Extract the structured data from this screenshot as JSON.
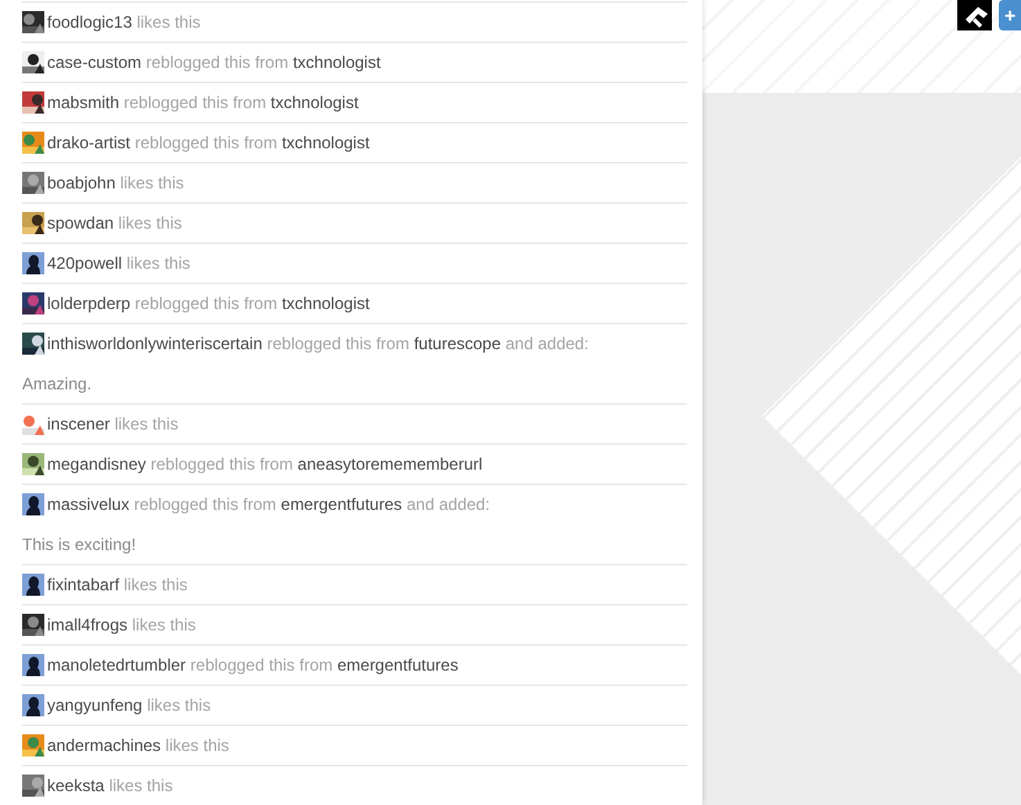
{
  "notes": [
    {
      "kind": "like",
      "user": "foodlogic13",
      "action": "likes this"
    },
    {
      "kind": "reblog",
      "user": "case-custom",
      "action": "reblogged this from",
      "source": "txchnologist"
    },
    {
      "kind": "reblog",
      "user": "mabsmith",
      "action": "reblogged this from",
      "source": "txchnologist"
    },
    {
      "kind": "reblog",
      "user": "drako-artist",
      "action": "reblogged this from",
      "source": "txchnologist"
    },
    {
      "kind": "like",
      "user": "boabjohn",
      "action": "likes this"
    },
    {
      "kind": "like",
      "user": "spowdan",
      "action": "likes this"
    },
    {
      "kind": "like",
      "avatar": {
        "kind": "silhouette"
      },
      "user": "420powell",
      "action": "likes this"
    },
    {
      "kind": "reblog",
      "user": "lolderpderp",
      "action": "reblogged this from",
      "source": "txchnologist"
    },
    {
      "kind": "reblog",
      "user": "inthisworldonlywinteriscertain",
      "action": "reblogged this from",
      "source": "futurescope",
      "added": "and added:",
      "comment": "Amazing."
    },
    {
      "kind": "like",
      "user": "inscener",
      "action": "likes this"
    },
    {
      "kind": "reblog",
      "user": "megandisney",
      "action": "reblogged this from",
      "source": "aneasytoremememberurl"
    },
    {
      "kind": "reblog",
      "avatar": {
        "kind": "silhouette"
      },
      "user": "massivelux",
      "action": "reblogged this from",
      "source": "emergentfutures",
      "added": "and added:",
      "comment": "This is exciting!"
    },
    {
      "kind": "like",
      "avatar": {
        "kind": "silhouette"
      },
      "user": "fixintabarf",
      "action": "likes this"
    },
    {
      "kind": "like",
      "user": "imall4frogs",
      "action": "likes this"
    },
    {
      "kind": "reblog",
      "avatar": {
        "kind": "silhouette"
      },
      "user": "manoletedrtumbler",
      "action": "reblogged this from",
      "source": "emergentfutures"
    },
    {
      "kind": "like",
      "avatar": {
        "kind": "silhouette"
      },
      "user": "yangyunfeng",
      "action": "likes this"
    },
    {
      "kind": "like",
      "user": "andermachines",
      "action": "likes this"
    },
    {
      "kind": "like",
      "user": "keeksta",
      "action": "likes this"
    }
  ],
  "toolbar": {
    "add_button": "+"
  }
}
